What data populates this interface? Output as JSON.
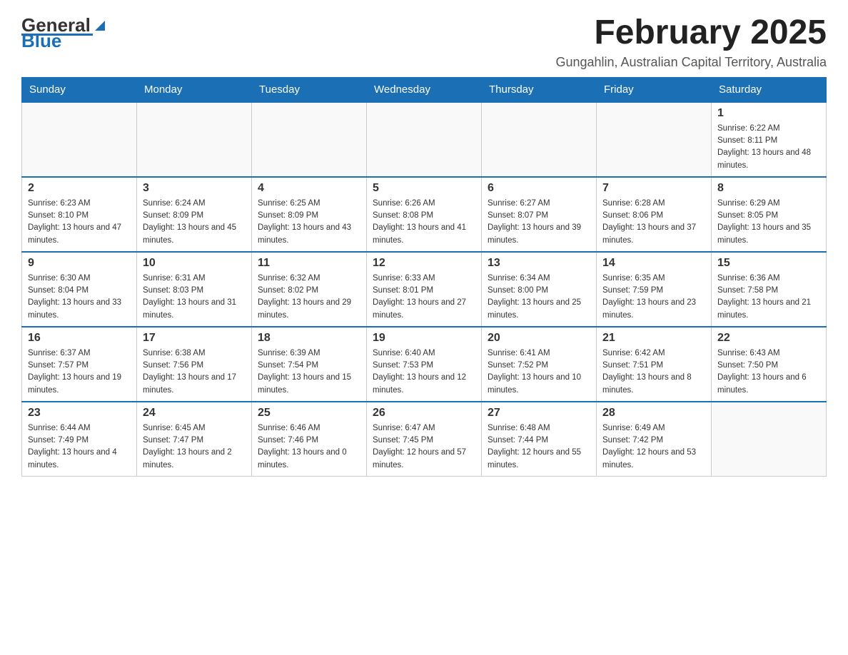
{
  "header": {
    "logo": {
      "text_general": "General",
      "text_blue": "Blue"
    },
    "month_title": "February 2025",
    "location": "Gungahlin, Australian Capital Territory, Australia"
  },
  "weekdays": [
    "Sunday",
    "Monday",
    "Tuesday",
    "Wednesday",
    "Thursday",
    "Friday",
    "Saturday"
  ],
  "weeks": [
    [
      {
        "day": "",
        "sunrise": "",
        "sunset": "",
        "daylight": ""
      },
      {
        "day": "",
        "sunrise": "",
        "sunset": "",
        "daylight": ""
      },
      {
        "day": "",
        "sunrise": "",
        "sunset": "",
        "daylight": ""
      },
      {
        "day": "",
        "sunrise": "",
        "sunset": "",
        "daylight": ""
      },
      {
        "day": "",
        "sunrise": "",
        "sunset": "",
        "daylight": ""
      },
      {
        "day": "",
        "sunrise": "",
        "sunset": "",
        "daylight": ""
      },
      {
        "day": "1",
        "sunrise": "Sunrise: 6:22 AM",
        "sunset": "Sunset: 8:11 PM",
        "daylight": "Daylight: 13 hours and 48 minutes."
      }
    ],
    [
      {
        "day": "2",
        "sunrise": "Sunrise: 6:23 AM",
        "sunset": "Sunset: 8:10 PM",
        "daylight": "Daylight: 13 hours and 47 minutes."
      },
      {
        "day": "3",
        "sunrise": "Sunrise: 6:24 AM",
        "sunset": "Sunset: 8:09 PM",
        "daylight": "Daylight: 13 hours and 45 minutes."
      },
      {
        "day": "4",
        "sunrise": "Sunrise: 6:25 AM",
        "sunset": "Sunset: 8:09 PM",
        "daylight": "Daylight: 13 hours and 43 minutes."
      },
      {
        "day": "5",
        "sunrise": "Sunrise: 6:26 AM",
        "sunset": "Sunset: 8:08 PM",
        "daylight": "Daylight: 13 hours and 41 minutes."
      },
      {
        "day": "6",
        "sunrise": "Sunrise: 6:27 AM",
        "sunset": "Sunset: 8:07 PM",
        "daylight": "Daylight: 13 hours and 39 minutes."
      },
      {
        "day": "7",
        "sunrise": "Sunrise: 6:28 AM",
        "sunset": "Sunset: 8:06 PM",
        "daylight": "Daylight: 13 hours and 37 minutes."
      },
      {
        "day": "8",
        "sunrise": "Sunrise: 6:29 AM",
        "sunset": "Sunset: 8:05 PM",
        "daylight": "Daylight: 13 hours and 35 minutes."
      }
    ],
    [
      {
        "day": "9",
        "sunrise": "Sunrise: 6:30 AM",
        "sunset": "Sunset: 8:04 PM",
        "daylight": "Daylight: 13 hours and 33 minutes."
      },
      {
        "day": "10",
        "sunrise": "Sunrise: 6:31 AM",
        "sunset": "Sunset: 8:03 PM",
        "daylight": "Daylight: 13 hours and 31 minutes."
      },
      {
        "day": "11",
        "sunrise": "Sunrise: 6:32 AM",
        "sunset": "Sunset: 8:02 PM",
        "daylight": "Daylight: 13 hours and 29 minutes."
      },
      {
        "day": "12",
        "sunrise": "Sunrise: 6:33 AM",
        "sunset": "Sunset: 8:01 PM",
        "daylight": "Daylight: 13 hours and 27 minutes."
      },
      {
        "day": "13",
        "sunrise": "Sunrise: 6:34 AM",
        "sunset": "Sunset: 8:00 PM",
        "daylight": "Daylight: 13 hours and 25 minutes."
      },
      {
        "day": "14",
        "sunrise": "Sunrise: 6:35 AM",
        "sunset": "Sunset: 7:59 PM",
        "daylight": "Daylight: 13 hours and 23 minutes."
      },
      {
        "day": "15",
        "sunrise": "Sunrise: 6:36 AM",
        "sunset": "Sunset: 7:58 PM",
        "daylight": "Daylight: 13 hours and 21 minutes."
      }
    ],
    [
      {
        "day": "16",
        "sunrise": "Sunrise: 6:37 AM",
        "sunset": "Sunset: 7:57 PM",
        "daylight": "Daylight: 13 hours and 19 minutes."
      },
      {
        "day": "17",
        "sunrise": "Sunrise: 6:38 AM",
        "sunset": "Sunset: 7:56 PM",
        "daylight": "Daylight: 13 hours and 17 minutes."
      },
      {
        "day": "18",
        "sunrise": "Sunrise: 6:39 AM",
        "sunset": "Sunset: 7:54 PM",
        "daylight": "Daylight: 13 hours and 15 minutes."
      },
      {
        "day": "19",
        "sunrise": "Sunrise: 6:40 AM",
        "sunset": "Sunset: 7:53 PM",
        "daylight": "Daylight: 13 hours and 12 minutes."
      },
      {
        "day": "20",
        "sunrise": "Sunrise: 6:41 AM",
        "sunset": "Sunset: 7:52 PM",
        "daylight": "Daylight: 13 hours and 10 minutes."
      },
      {
        "day": "21",
        "sunrise": "Sunrise: 6:42 AM",
        "sunset": "Sunset: 7:51 PM",
        "daylight": "Daylight: 13 hours and 8 minutes."
      },
      {
        "day": "22",
        "sunrise": "Sunrise: 6:43 AM",
        "sunset": "Sunset: 7:50 PM",
        "daylight": "Daylight: 13 hours and 6 minutes."
      }
    ],
    [
      {
        "day": "23",
        "sunrise": "Sunrise: 6:44 AM",
        "sunset": "Sunset: 7:49 PM",
        "daylight": "Daylight: 13 hours and 4 minutes."
      },
      {
        "day": "24",
        "sunrise": "Sunrise: 6:45 AM",
        "sunset": "Sunset: 7:47 PM",
        "daylight": "Daylight: 13 hours and 2 minutes."
      },
      {
        "day": "25",
        "sunrise": "Sunrise: 6:46 AM",
        "sunset": "Sunset: 7:46 PM",
        "daylight": "Daylight: 13 hours and 0 minutes."
      },
      {
        "day": "26",
        "sunrise": "Sunrise: 6:47 AM",
        "sunset": "Sunset: 7:45 PM",
        "daylight": "Daylight: 12 hours and 57 minutes."
      },
      {
        "day": "27",
        "sunrise": "Sunrise: 6:48 AM",
        "sunset": "Sunset: 7:44 PM",
        "daylight": "Daylight: 12 hours and 55 minutes."
      },
      {
        "day": "28",
        "sunrise": "Sunrise: 6:49 AM",
        "sunset": "Sunset: 7:42 PM",
        "daylight": "Daylight: 12 hours and 53 minutes."
      },
      {
        "day": "",
        "sunrise": "",
        "sunset": "",
        "daylight": ""
      }
    ]
  ]
}
